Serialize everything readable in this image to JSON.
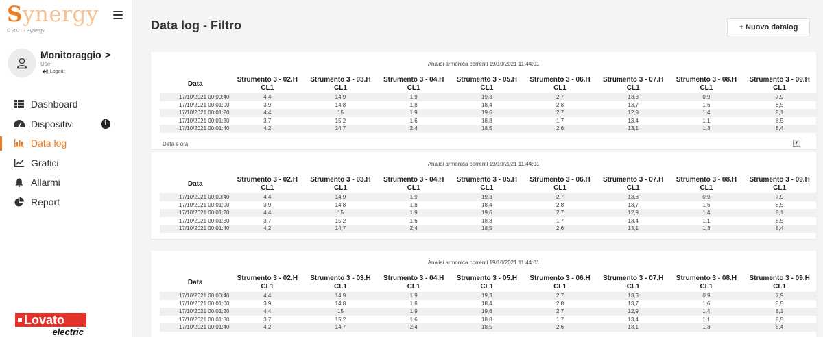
{
  "brand": {
    "logo_first": "S",
    "logo_rest": "ynergy",
    "copyright": "© 2021 - Synergy",
    "footer_logo_top": "Lovato",
    "footer_logo_bottom": "electric",
    "accent": "#f07c1e"
  },
  "user": {
    "name": "Monitoraggio",
    "chevron": ">",
    "role": "User",
    "logout": "Logout"
  },
  "nav": [
    {
      "label": "Dashboard",
      "icon": "grid-icon"
    },
    {
      "label": "Dispositivi",
      "icon": "gauge-icon",
      "badge": "i"
    },
    {
      "label": "Data log",
      "icon": "bar-chart-icon",
      "active": true
    },
    {
      "label": "Grafici",
      "icon": "line-chart-icon"
    },
    {
      "label": "Allarmi",
      "icon": "bell-icon"
    },
    {
      "label": "Report",
      "icon": "pie-chart-icon"
    }
  ],
  "page": {
    "title": "Data log - Filtro",
    "new_button": "+ Nuovo datalog"
  },
  "table": {
    "date_header": "Data",
    "columns": [
      {
        "name": "Strumento 3 - 02.H",
        "unit": "CL1"
      },
      {
        "name": "Strumento 3 - 03.H",
        "unit": "CL1"
      },
      {
        "name": "Strumento 3 - 04.H",
        "unit": "CL1"
      },
      {
        "name": "Strumento 3 - 05.H",
        "unit": "CL1"
      },
      {
        "name": "Strumento 3 - 06.H",
        "unit": "CL1"
      },
      {
        "name": "Strumento 3 - 07.H",
        "unit": "CL1"
      },
      {
        "name": "Strumento 3 - 08.H",
        "unit": "CL1"
      },
      {
        "name": "Strumento 3 - 09.H",
        "unit": "CL1"
      }
    ],
    "rows": [
      [
        "17/10/2021 00:00:40",
        "4,4",
        "14,9",
        "1,9",
        "19,3",
        "2,7",
        "13,3",
        "0,9",
        "7,9"
      ],
      [
        "17/10/2021 00:01:00",
        "3,9",
        "14,8",
        "1,8",
        "18,4",
        "2,8",
        "13,7",
        "1,6",
        "8,5"
      ],
      [
        "17/10/2021 00:01:20",
        "4,4",
        "15",
        "1,9",
        "19,6",
        "2,7",
        "12,9",
        "1,4",
        "8,1"
      ],
      [
        "17/10/2021 00:01:30",
        "3,7",
        "15,2",
        "1,6",
        "18,8",
        "1,7",
        "13,4",
        "1,1",
        "8,5"
      ],
      [
        "17/10/2021 00:01:40",
        "4,2",
        "14,7",
        "2,4",
        "18,5",
        "2,6",
        "13,1",
        "1,3",
        "8,4"
      ]
    ]
  },
  "panels": [
    {
      "title": "Analisi armonica correnti 19/10/2021 11:44:01",
      "filter_label": "Data e ora"
    },
    {
      "title": "Analisi armonica correnti 19/10/2021 11:44:01"
    },
    {
      "title": "Analisi armonica correnti 19/10/2021 11:44:01"
    }
  ]
}
